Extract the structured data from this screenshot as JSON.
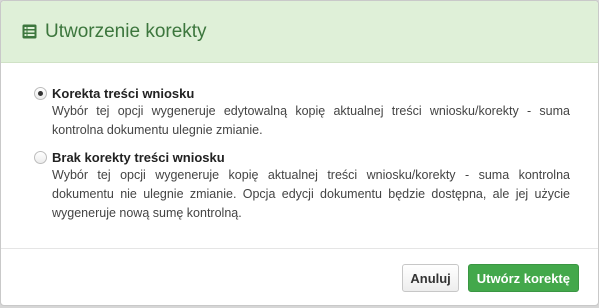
{
  "dialog": {
    "title": "Utworzenie korekty",
    "header_icon": "list-alt-icon",
    "accent_color": "#3c763d",
    "header_bg": "#dff0d8"
  },
  "options": [
    {
      "label": "Korekta treści wniosku",
      "description": "Wybór tej opcji wygeneruje edytowalną kopię aktualnej treści wniosku/korekty - suma kontrolna dokumentu ulegnie zmianie.",
      "selected": true
    },
    {
      "label": "Brak korekty treści wniosku",
      "description": "Wybór tej opcji wygeneruje kopię aktualnej treści wniosku/korekty - suma kontrolna dokumentu nie ulegnie zmianie. Opcja edycji dokumentu będzie dostępna, ale jej użycie wygeneruje nową sumę kontrolną.",
      "selected": false
    }
  ],
  "footer": {
    "cancel_label": "Anuluj",
    "confirm_label": "Utwórz korektę",
    "confirm_color": "#43a84b"
  }
}
